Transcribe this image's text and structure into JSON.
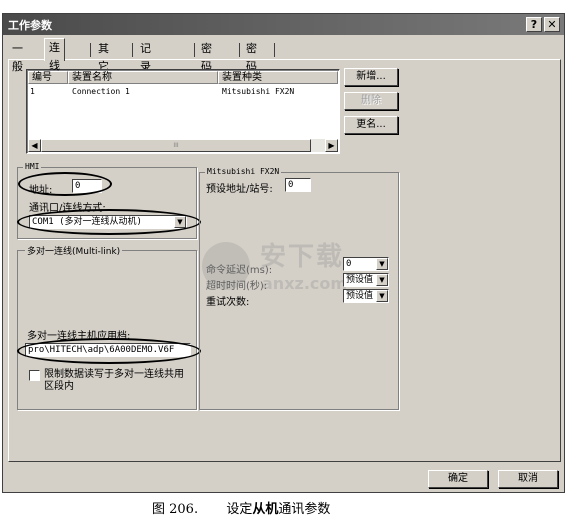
{
  "window": {
    "title": "工作参数",
    "help_glyph": "?",
    "close_glyph": "✕"
  },
  "tabs": [
    "一般",
    "连线",
    "其它",
    "记录缓冲区",
    "密码表",
    "密码"
  ],
  "devices": {
    "columns": [
      "编号",
      "装置名称",
      "装置种类"
    ],
    "rows": [
      {
        "id": "1",
        "name": "Connection 1",
        "type": "Mitsubishi FX2N"
      }
    ],
    "scroll_left": "◀",
    "scroll_right": "▶",
    "scroll_thumb": "III"
  },
  "device_buttons": {
    "add": "新增...",
    "delete": "删除",
    "rename": "更名..."
  },
  "hmi": {
    "group_label": "HMI",
    "address_label": "地址:",
    "address_value": "0",
    "comm_mode_label": "通讯口/连线方式:",
    "comm_mode_value": "COM1 (多对一连线从动机)"
  },
  "multilink": {
    "group_label": "多对一连线(Multi-link)",
    "master_app_label": "多对一连线主机应用档:",
    "master_app_value": "pro\\HITECH\\adp\\6A00DEMO.V6F",
    "restrict_label_1": "限制数据读写于多对一连线共用",
    "restrict_label_2": "区段内"
  },
  "plc": {
    "group_label": "Mitsubishi FX2N",
    "default_address_label": "预设地址/站号:",
    "default_address_value": "0",
    "cmd_delay_label": "命令延迟(ms):",
    "cmd_delay_value": "0",
    "timeout_label": "超时时间(秒):",
    "timeout_value": "预设值",
    "retries_label": "重试次数:",
    "retries_value": "预设值"
  },
  "footer": {
    "ok": "确定",
    "cancel": "取消"
  },
  "caption": {
    "figure": "图 206.",
    "text_pre": "设定",
    "text_bold": "从机",
    "text_post": "通讯参数"
  },
  "watermark": {
    "text": "安下载",
    "domain": "anxz.com"
  },
  "icons": {
    "dropdown": "▼"
  }
}
